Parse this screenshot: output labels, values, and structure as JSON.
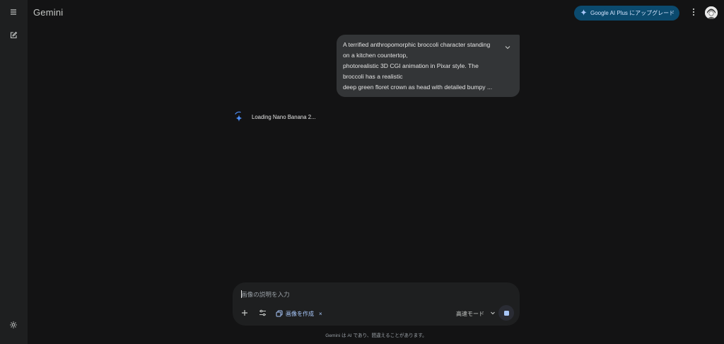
{
  "app": {
    "title": "Gemini"
  },
  "sidebar": {
    "menu_icon": "menu-icon",
    "new_chat_icon": "edit-icon",
    "settings_icon": "gear-icon"
  },
  "header": {
    "upgrade_label": "Google AI Plus にアップグレード",
    "more_icon": "more-vert-icon",
    "avatar_icon": "avatar-icon"
  },
  "conversation": {
    "user_message_lines": [
      "A terrified anthropomorphic broccoli character standing",
      "on a kitchen countertop,",
      "photorealistic 3D CGI animation in Pixar style. The",
      "broccoli has a realistic",
      "deep green floret crown as head with detailed bumpy ..."
    ],
    "loading_text": "Loading Nano Banana 2..."
  },
  "composer": {
    "placeholder": "画像の説明を入力",
    "value": "",
    "chip_label": "画像を作成",
    "chip_close": "×",
    "mode_label": "高速モード"
  },
  "footer": {
    "disclaimer": "Gemini は AI であり、間違えることがあります。"
  },
  "colors": {
    "background": "#131314",
    "sidebar": "#1e1f20",
    "bubble": "#333537",
    "accent_blue": "#a8c7fa",
    "upgrade_button": "#0b4a6e"
  }
}
